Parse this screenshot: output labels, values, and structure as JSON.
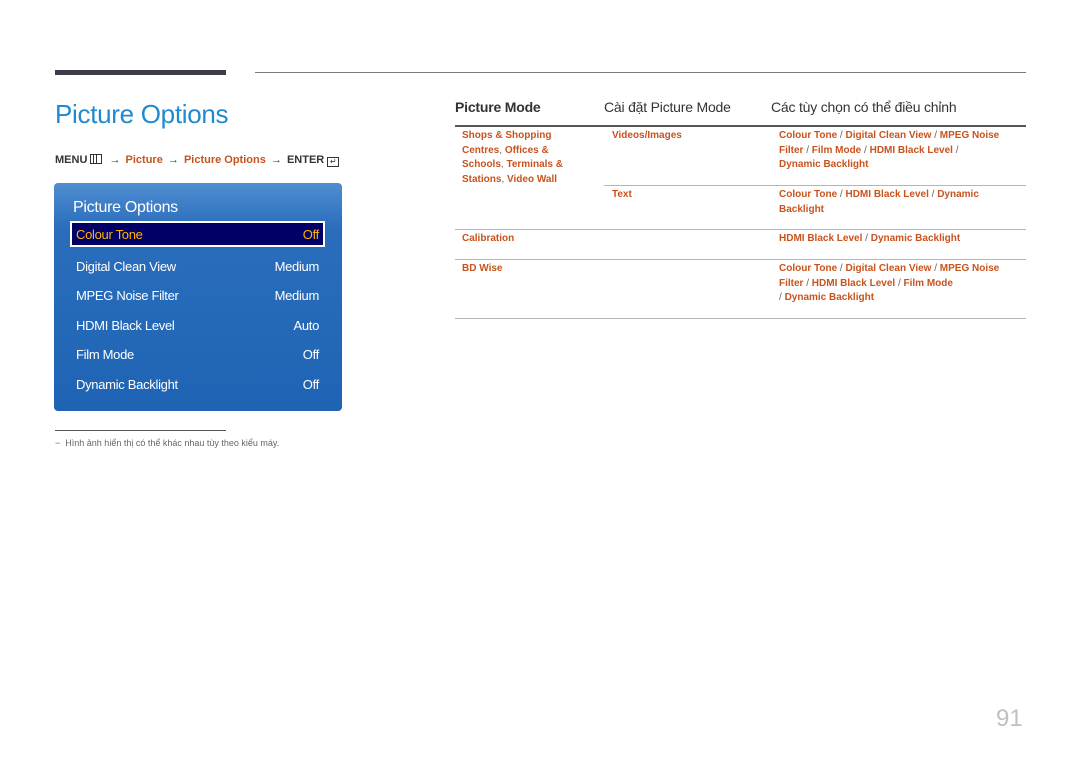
{
  "page": {
    "title": "Picture Options",
    "page_number": "91"
  },
  "breadcrumb": {
    "menu": "MENU",
    "menu_icon": "menu-icon",
    "arrow": "→",
    "picture": "Picture",
    "picture_options": "Picture Options",
    "enter": "ENTER",
    "enter_icon": "enter-icon"
  },
  "osd": {
    "title": "Picture Options",
    "items": [
      {
        "label": "Colour Tone",
        "value": "Off",
        "selected": true
      },
      {
        "label": "Digital Clean View",
        "value": "Medium"
      },
      {
        "label": "MPEG Noise Filter",
        "value": "Medium"
      },
      {
        "label": "HDMI Black Level",
        "value": "Auto"
      },
      {
        "label": "Film Mode",
        "value": "Off"
      },
      {
        "label": "Dynamic Backlight",
        "value": "Off"
      }
    ],
    "colors": {
      "selected_text": "#ffb400",
      "selected_bg": "#000066",
      "panel": "#1f64b4"
    }
  },
  "footnote": "Hình ảnh hiển thị có thể khác nhau tùy theo kiểu máy.",
  "table": {
    "headers": [
      "Picture Mode",
      "Cài đặt Picture Mode",
      "Các tùy chọn có thể điều chỉnh"
    ],
    "rows": [
      {
        "mode_lines": [
          "Shops & Shopping",
          "Centres",
          "Offices &",
          "Schools",
          "Terminals &",
          "Stations",
          "Video Wall"
        ],
        "settings": [
          {
            "name": "Videos/Images",
            "options": [
              "Colour Tone",
              "Digital Clean View",
              "MPEG Noise Filter",
              "Film Mode",
              "HDMI Black Level",
              "Dynamic Backlight"
            ]
          },
          {
            "name": "Text",
            "options": [
              "Colour Tone",
              "HDMI Black Level",
              "Dynamic Backlight"
            ]
          }
        ]
      },
      {
        "mode": "Calibration",
        "setting": "",
        "options": [
          "HDMI Black Level",
          "Dynamic Backlight"
        ]
      },
      {
        "mode": "BD Wise",
        "setting": "",
        "options": [
          "Colour Tone",
          "Digital Clean View",
          "MPEG Noise Filter",
          "HDMI Black Level",
          "Film Mode",
          "Dynamic Backlight"
        ]
      }
    ],
    "separator": "/",
    "colors": {
      "link": "#c8531d",
      "title": "#1f8ad0"
    }
  }
}
